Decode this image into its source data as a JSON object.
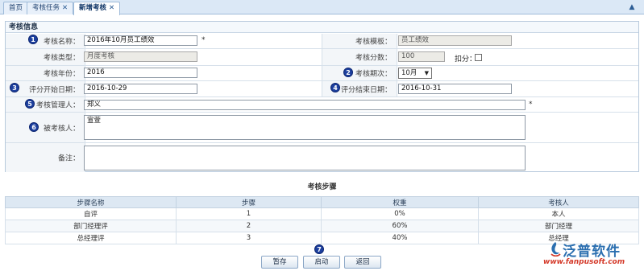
{
  "tabs": [
    {
      "label": "首页",
      "closable": false,
      "active": false
    },
    {
      "label": "考核任务",
      "closable": true,
      "active": false
    },
    {
      "label": "新增考核",
      "closable": true,
      "active": true
    }
  ],
  "form": {
    "section_title": "考核信息",
    "name": {
      "label": "考核名称：",
      "value": "2016年10月员工绩效",
      "required": "*"
    },
    "template": {
      "label": "考核模板：",
      "value": "员工绩效"
    },
    "type": {
      "label": "考核类型：",
      "value": "月度考核"
    },
    "score": {
      "label": "考核分数：",
      "value": "100"
    },
    "deduct": {
      "label": "扣分：",
      "checked": false
    },
    "year": {
      "label": "考核年份：",
      "value": "2016"
    },
    "period": {
      "label": "考核期次：",
      "value": "10月"
    },
    "start_date": {
      "label": "评分开始日期：",
      "value": "2016-10-29"
    },
    "end_date": {
      "label": "评分结束日期：",
      "value": "2016-10-31"
    },
    "manager": {
      "label": "考核管理人：",
      "value": "郑义",
      "required": "*"
    },
    "assessee": {
      "label": "被考核人：",
      "value": "宣萱"
    },
    "remark": {
      "label": "备注：",
      "value": ""
    }
  },
  "markers": [
    "1",
    "2",
    "3",
    "4",
    "5",
    "6",
    "7"
  ],
  "steps": {
    "title": "考核步骤",
    "columns": [
      "步骤名称",
      "步骤",
      "权重",
      "考核人"
    ],
    "rows": [
      [
        "自评",
        "1",
        "0%",
        "本人"
      ],
      [
        "部门经理评",
        "2",
        "60%",
        "部门经理"
      ],
      [
        "总经理评",
        "3",
        "40%",
        "总经理"
      ]
    ]
  },
  "buttons": {
    "save": "暂存",
    "start": "启动",
    "back": "返回"
  },
  "watermark": {
    "brand": "泛普软件",
    "url": "www.fanpusoft.com"
  },
  "colors": {
    "marker": "#1c3f9e",
    "header": "#dde8f3",
    "tabbar": "#dbe8f6"
  }
}
